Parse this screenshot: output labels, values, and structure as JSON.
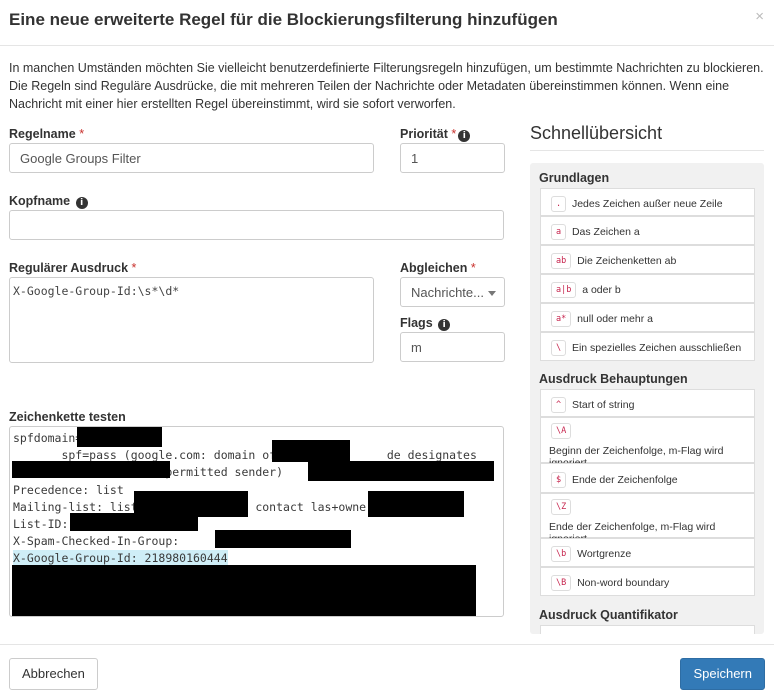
{
  "dialog": {
    "title": "Eine neue erweiterte Regel für die Blockierungsfilterung hinzufügen",
    "close_glyph": "×",
    "intro": "In manchen Umständen möchten Sie vielleicht benutzerdefinierte Filterungsregeln hinzufügen, um bestimmte Nachrichten zu blockieren. Die Regeln sind Reguläre Ausdrücke, die mit mehreren Teilen der Nachrichte oder Metadaten übereinstimmen können. Wenn eine Nachricht mit einer hier erstellten Regel übereinstimmt, wird sie sofort verworfen."
  },
  "form": {
    "rule_name": {
      "label": "Regelname",
      "required": "*",
      "value": "Google Groups Filter"
    },
    "priority": {
      "label": "Priorität",
      "required": "*",
      "value": "1"
    },
    "header_name": {
      "label": "Kopfname",
      "value": ""
    },
    "regex": {
      "label": "Regulärer Ausdruck",
      "required": "*",
      "value": "X-Google-Group-Id:\\s*\\d*"
    },
    "match": {
      "label": "Abgleichen",
      "required": "*",
      "value": "Nachrichte..."
    },
    "flags": {
      "label": "Flags",
      "value": "m"
    },
    "test": {
      "label": "Zeichenkette testen",
      "lines": [
        "spfdomain=",
        "       spf=pass (google.com: domain of                de designates",
        "                   as permitted sender)",
        "Precedence: list",
        "Mailing-list: list                 contact las+owner",
        "List-ID:",
        "X-Spam-Checked-In-Group:",
        "X-Google-Group-Id: 218980160444"
      ]
    }
  },
  "sidebar": {
    "title": "Schnellübersicht",
    "sections": [
      {
        "title": "Grundlagen",
        "items": [
          {
            "code": ".",
            "text": "Jedes Zeichen außer neue Zeile"
          },
          {
            "code": "a",
            "text": "Das Zeichen a"
          },
          {
            "code": "ab",
            "text": "Die Zeichenketten ab"
          },
          {
            "code": "a|b",
            "text": "a oder b"
          },
          {
            "code": "a*",
            "text": "null oder mehr a"
          },
          {
            "code": "\\",
            "text": "Ein spezielles Zeichen ausschließen"
          }
        ]
      },
      {
        "title": "Ausdruck Behauptungen",
        "items": [
          {
            "code": "^",
            "text": "Start of string"
          },
          {
            "code": "\\A",
            "text": "Beginn der Zeichenfolge, m-Flag wird ignoriert"
          },
          {
            "code": "$",
            "text": "Ende der Zeichenfolge"
          },
          {
            "code": "\\Z",
            "text": "Ende der Zeichenfolge, m-Flag wird ignoriert"
          },
          {
            "code": "\\b",
            "text": "Wortgrenze"
          },
          {
            "code": "\\B",
            "text": "Non-word boundary"
          }
        ]
      },
      {
        "title": "Ausdruck Quantifikator",
        "items": []
      }
    ]
  },
  "footer": {
    "cancel_label": "Abbrechen",
    "save_label": "Speichern"
  },
  "colors": {
    "primary": "#337ab7",
    "required": "#c9302c",
    "code": "#c7254e",
    "highlight": "#cfeef7"
  }
}
